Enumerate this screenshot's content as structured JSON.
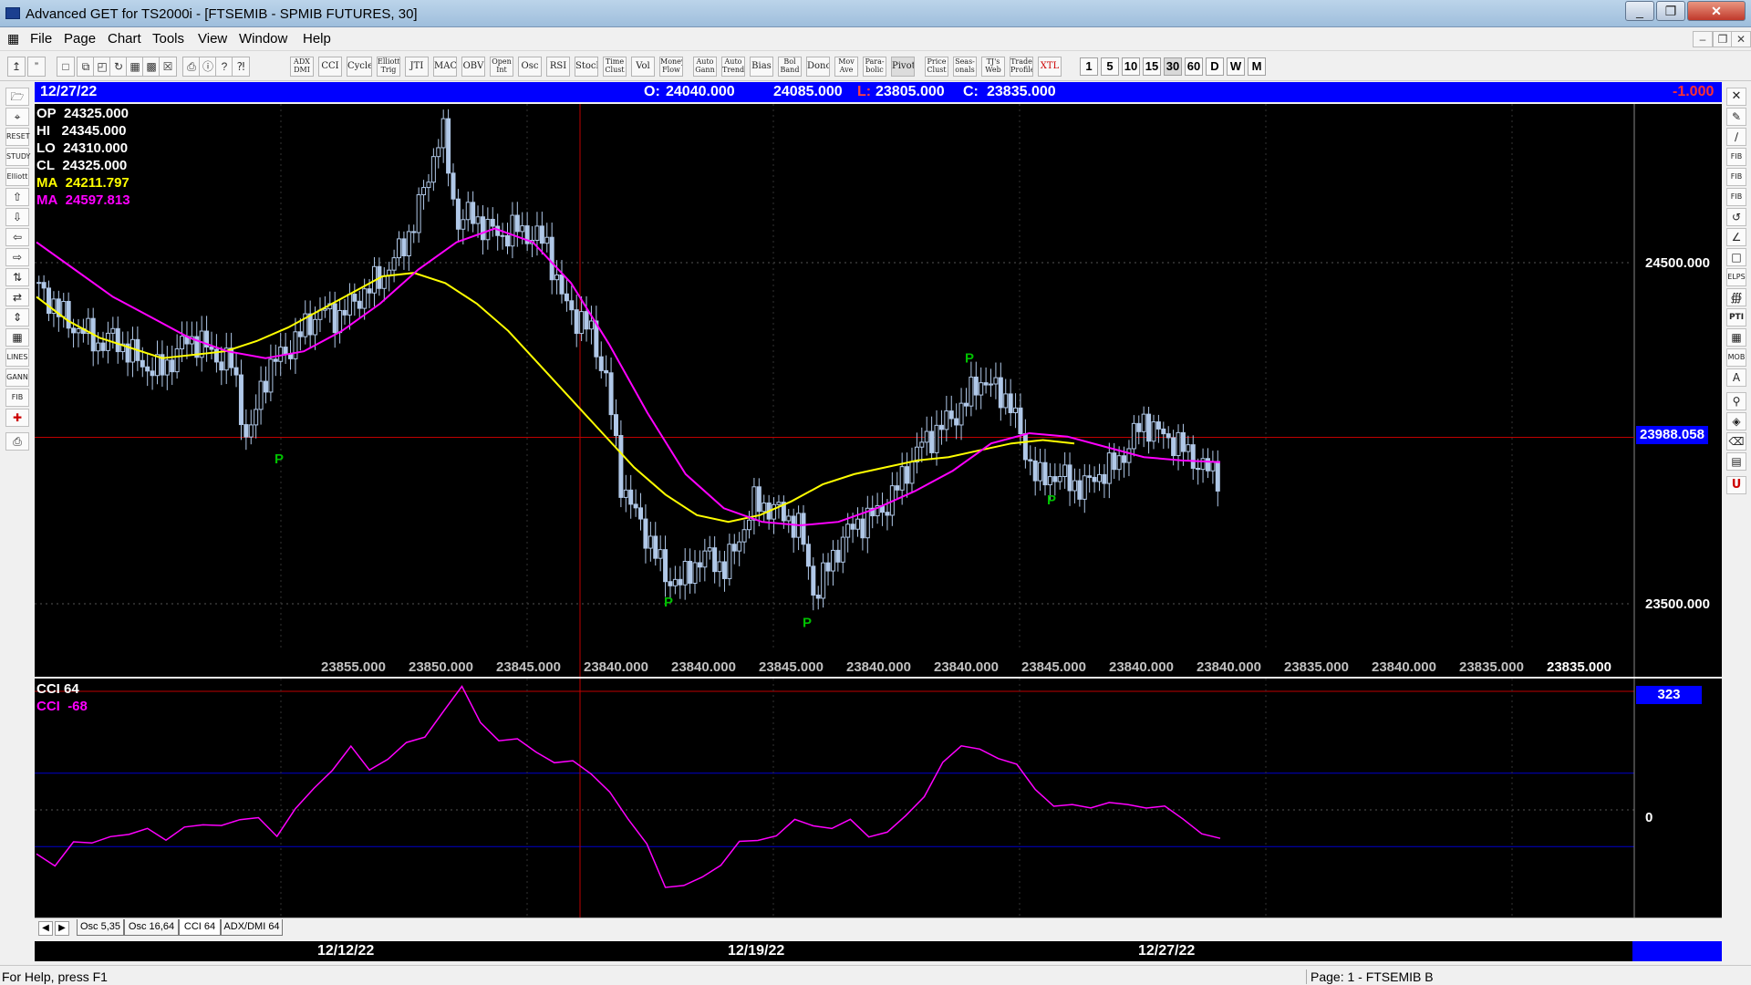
{
  "window": {
    "title": "Advanced GET for TS2000i - [FTSEMIB - SPMIB FUTURES, 30]",
    "controls": [
      "_",
      "❐",
      "✕"
    ]
  },
  "menu": {
    "items": [
      "File",
      "Page",
      "Chart",
      "Tools",
      "View",
      "Window",
      "Help"
    ],
    "mdi_controls": [
      "–",
      "❐",
      "✕"
    ]
  },
  "toolbar": {
    "indicator_buttons": [
      "ADX DMI",
      "CCI",
      "Cycles",
      "Elliott Trig",
      "JTI",
      "MACD",
      "OBV",
      "Open Int",
      "Osc",
      "RSI",
      "Stoch",
      "Time Clust",
      "Vol",
      "Money Flow",
      "Auto Gann",
      "Auto Trend",
      "Bias",
      "Bol Band",
      "Donch",
      "Mov Ave",
      "Para- bolic",
      "Pivot",
      "Price Clust",
      "Seas- onals",
      "TJ's Web",
      "Trade Profile",
      "XTL"
    ],
    "timeframes": [
      "1",
      "5",
      "10",
      "15",
      "30",
      "60",
      "D",
      "W",
      "M"
    ],
    "active_timeframe": "30"
  },
  "chart_header": {
    "date": "12/27/22",
    "open_label": "O:",
    "open": "24040.000",
    "high": "24085.000",
    "low_label": "L:",
    "low": "23805.000",
    "close_label": "C:",
    "close": "23835.000",
    "change": "-1.000"
  },
  "info": {
    "op_label": "OP",
    "op": "24325.000",
    "hi_label": "HI",
    "hi": "24345.000",
    "lo_label": "LO",
    "lo": "24310.000",
    "cl_label": "CL",
    "cl": "24325.000",
    "ma1_label": "MA",
    "ma1": "24211.797",
    "ma2_label": "MA",
    "ma2": "24597.813"
  },
  "price_axis": {
    "ticks": [
      "24500.000",
      "23500.000"
    ],
    "current": "23988.058"
  },
  "bottom_values": [
    "23855.000",
    "23850.000",
    "23845.000",
    "23840.000",
    "23840.000",
    "23845.000",
    "23840.000",
    "23840.000",
    "23845.000",
    "23840.000",
    "23840.000",
    "23835.000",
    "23840.000",
    "23835.000",
    "23835.000"
  ],
  "pivot_label": "P",
  "oscillator": {
    "title": "CCI 64",
    "value_label": "CCI",
    "value": "-68",
    "axis_top": "323",
    "axis_zero": "0"
  },
  "tabs": [
    "Osc 5,35",
    "Osc 16,64",
    "CCI 64",
    "ADX/DMI 64"
  ],
  "active_tab": "CCI 64",
  "dates": [
    "12/12/22",
    "12/19/22",
    "12/27/22"
  ],
  "status": {
    "help": "For Help, press F1",
    "page": "Page: 1 - FTSEMIB B"
  },
  "colors": {
    "price_bars": "#b0c8e8",
    "ma_fast": "#ffff00",
    "ma_slow": "#ff00ff",
    "cci": "#ff00ff",
    "pivot": "#00c000",
    "header": "#0000ff",
    "crosshair": "#c00000"
  },
  "chart_data": {
    "type": "candlestick",
    "price_series_anchors": {
      "date_labels": [
        "12/12/22",
        "12/19/22",
        "12/27/22"
      ],
      "values": [
        24420,
        24380,
        24320,
        24300,
        24260,
        24280,
        24240,
        24200,
        24180,
        24220,
        24280,
        24260,
        24220,
        24200,
        23960,
        24160,
        24220,
        24260,
        24320,
        24360,
        24340,
        24380,
        24420,
        24460,
        24520,
        24600,
        24740,
        24900,
        24620,
        24640,
        24600,
        24580,
        24600,
        24580,
        24560,
        24400,
        24340,
        24300,
        24160,
        23860,
        23760,
        23680,
        23580,
        23560,
        23620,
        23640,
        23600,
        23700,
        23800,
        23780,
        23760,
        23720,
        23520,
        23620,
        23700,
        23740,
        23760,
        23800,
        23880,
        23960,
        24000,
        24040,
        24080,
        24160,
        24130,
        24100,
        23960,
        23860,
        23880,
        23860,
        23840,
        23880,
        23900,
        23960,
        24040,
        24000,
        23980,
        23940,
        23900,
        23880
      ]
    },
    "moving_average_fast": {
      "name": "MA",
      "last": 24211.797,
      "values": [
        24400,
        24330,
        24280,
        24250,
        24220,
        24230,
        24240,
        24270,
        24310,
        24360,
        24410,
        24460,
        24470,
        24440,
        24380,
        24300,
        24200,
        24100,
        24000,
        23900,
        23820,
        23760,
        23740,
        23760,
        23800,
        23850,
        23880,
        23900,
        23920,
        23930,
        23950,
        23970,
        23980,
        23970
      ]
    },
    "moving_average_slow": {
      "name": "MA",
      "last": 24597.813,
      "values": [
        24560,
        24480,
        24400,
        24340,
        24280,
        24240,
        24220,
        24240,
        24300,
        24380,
        24480,
        24560,
        24600,
        24560,
        24440,
        24260,
        24060,
        23880,
        23780,
        23740,
        23730,
        23740,
        23780,
        23830,
        23890,
        23970,
        24000,
        23990,
        23960,
        23930,
        23920,
        23915
      ]
    },
    "pivots": [
      {
        "type": "low",
        "price": 23960
      },
      {
        "type": "low",
        "price": 23540
      },
      {
        "type": "low",
        "price": 23480
      },
      {
        "type": "high",
        "price": 24180
      },
      {
        "type": "low",
        "price": 23840
      }
    ],
    "cci": {
      "name": "CCI 64",
      "last": -68,
      "axis": [
        "323",
        "0"
      ],
      "values": [
        -120,
        -140,
        -100,
        -90,
        -60,
        -80,
        -50,
        -70,
        -60,
        -40,
        -30,
        -40,
        -20,
        -60,
        -10,
        60,
        120,
        160,
        110,
        150,
        170,
        200,
        280,
        323,
        240,
        200,
        180,
        160,
        140,
        120,
        100,
        60,
        -40,
        -90,
        -200,
        -220,
        -180,
        -140,
        -100,
        -80,
        -60,
        -40,
        -40,
        -40,
        -40,
        -70,
        -50,
        -30,
        40,
        140,
        160,
        170,
        150,
        110,
        60,
        20,
        0,
        10,
        30,
        0,
        10,
        20,
        -40,
        -60,
        -68
      ]
    }
  }
}
